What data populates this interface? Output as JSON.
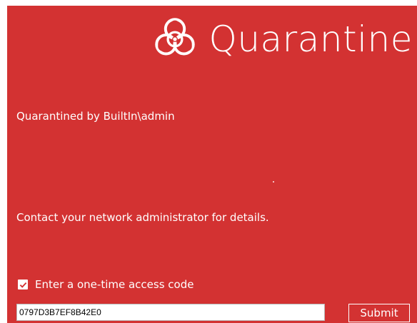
{
  "brand": {
    "icon": "biohazard-icon",
    "title": "Quarantine"
  },
  "messages": {
    "quarantined_by": "Quarantined by BuiltIn\\admin",
    "contact": "Contact your network administrator for details."
  },
  "access": {
    "checkbox_label": "Enter a one-time access code",
    "checked": true,
    "code_value": "0797D3B7EF8B42E0",
    "submit_label": "Submit"
  },
  "colors": {
    "background": "#d33232",
    "text": "#ffffff"
  }
}
